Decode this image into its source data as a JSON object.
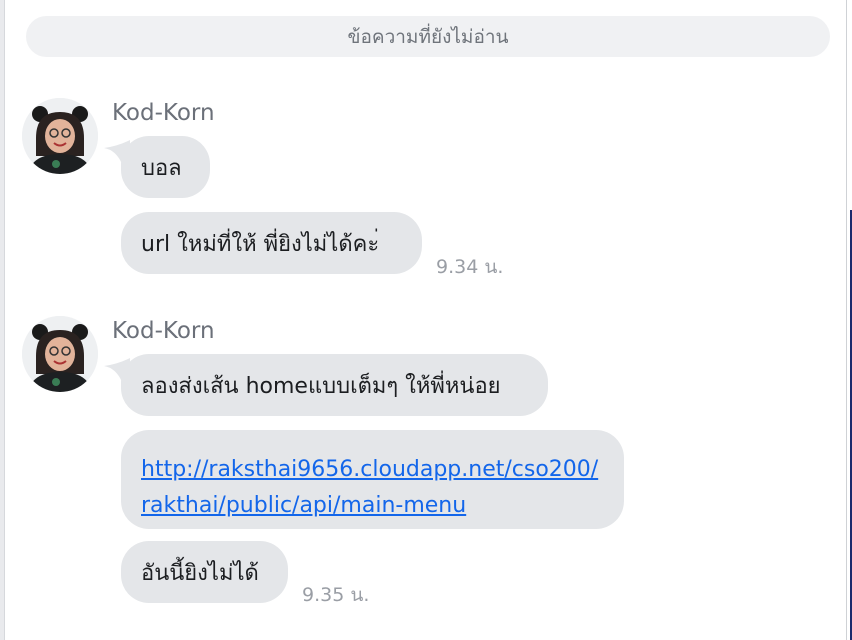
{
  "header": {
    "unread_label": "ข้อความที่ยังไม่อ่าน"
  },
  "messages": [
    {
      "sender": "Kod-Korn",
      "bubbles": [
        "บอล",
        "url  ใหม่ที่ให้ พี่ยิงไม่ได้คะ่"
      ],
      "time": "9.34 น."
    },
    {
      "sender": "Kod-Korn",
      "bubbles": [
        "ลองส่งเส้น homeแบบเต็มๆ  ให้พี่หน่อย"
      ],
      "link": {
        "line1": "http://raksthai9656.cloudapp.net/cso200/",
        "line2": "rakthai/public/api/main-menu"
      },
      "last_bubble": "อันนี้ยิงไม่ได้",
      "time": "9.35 น."
    }
  ],
  "icons": {
    "avatar": "user-photo-avatar"
  },
  "colors": {
    "bubble": "#e4e6e9",
    "link": "#1366ea",
    "sender": "#6b7079",
    "time": "#9a9ea5",
    "unread_bar": "#f0f1f3"
  }
}
